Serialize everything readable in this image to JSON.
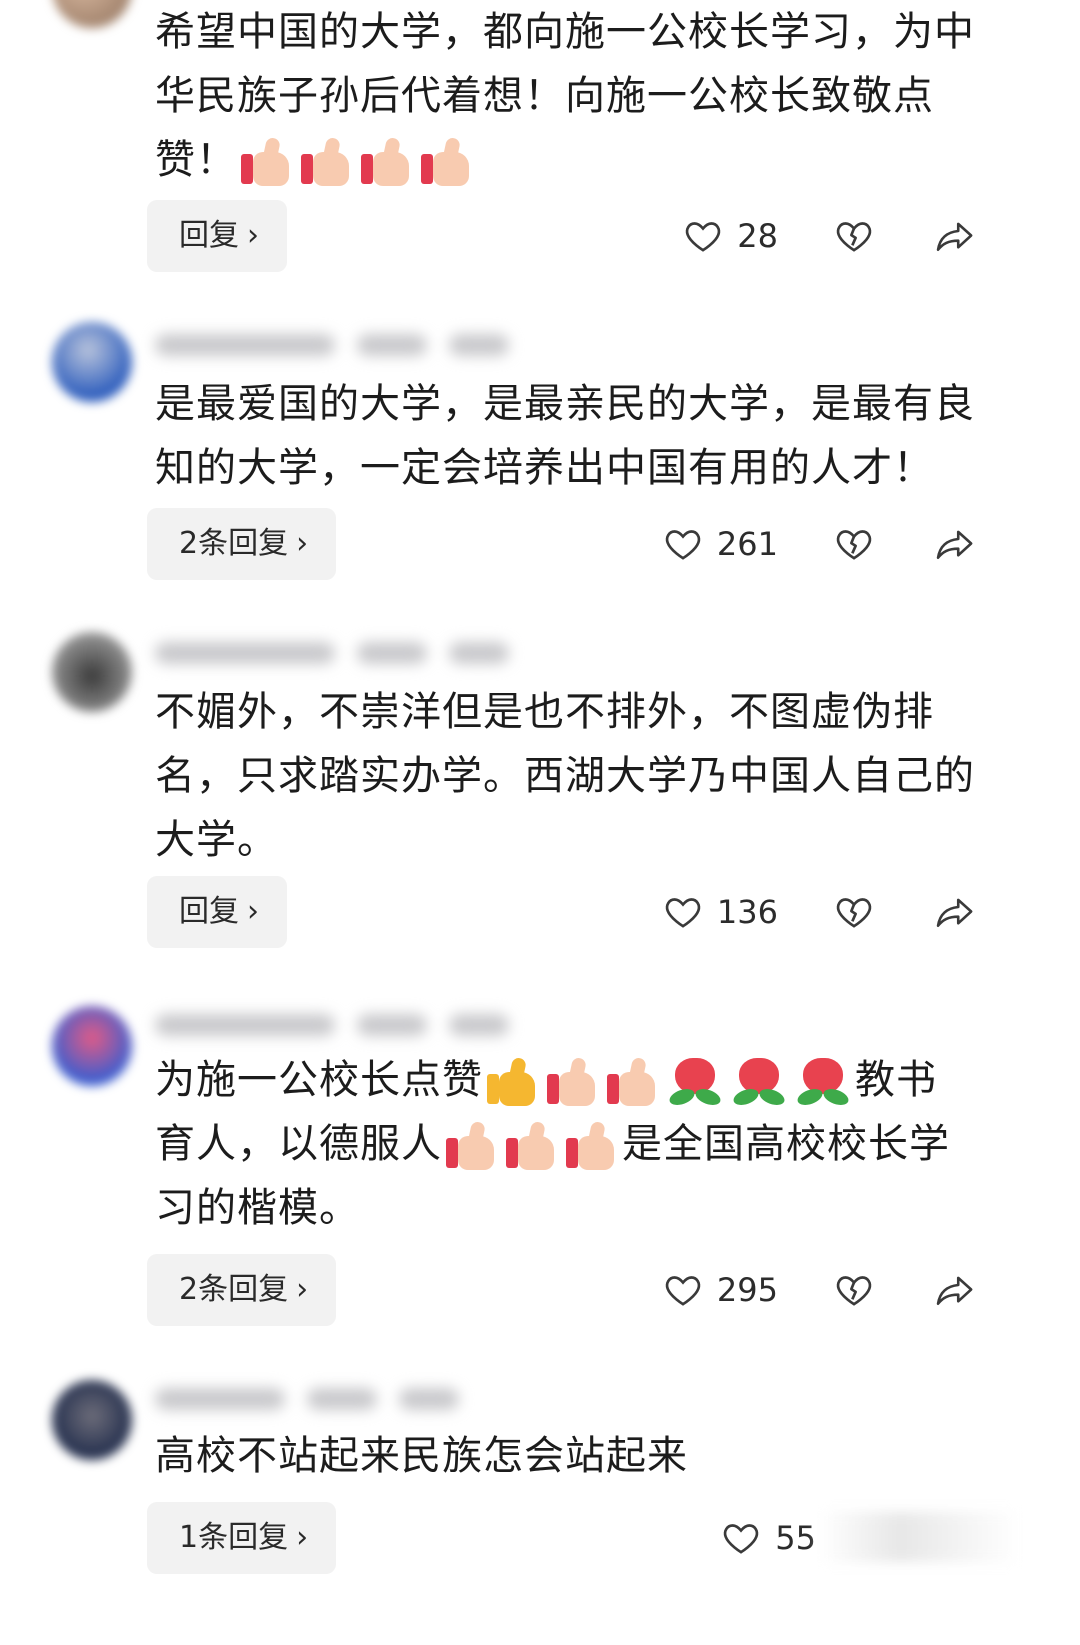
{
  "comments": [
    {
      "text_lines": [
        "希望中国的大学，都向施一公校长学习，为中",
        "华民族子孙后代着想！向施一公校长致敬点",
        "赞！"
      ],
      "reply_label": "回复",
      "likes": "28"
    },
    {
      "text_lines": [
        "是最爱国的大学，是最亲民的大学，是最有良",
        "知的大学，一定会培养出中国有用的人才！"
      ],
      "reply_label": "2条回复",
      "likes": "261"
    },
    {
      "text_lines": [
        "不媚外，不崇洋但是也不排外，不图虚伪排",
        "名，只求踏实办学。西湖大学乃中国人自己的",
        "大学。"
      ],
      "reply_label": "回复",
      "likes": "136"
    },
    {
      "text_parts": {
        "l1a": "为施一公校长点赞",
        "l1b": "教书",
        "l2a": "育人，以德服人",
        "l2b": "是全国高校校长学",
        "l3": "习的楷模。"
      },
      "reply_label": "2条回复",
      "likes": "295"
    },
    {
      "text_lines": [
        "高校不站起来民族怎会站起来"
      ],
      "reply_label": "1条回复",
      "likes": "55"
    }
  ],
  "icons": {
    "like": "heart-outline-icon",
    "dislike": "broken-heart-icon",
    "share": "share-arrow-icon",
    "chevron": "chevron-right-icon"
  },
  "colors": {
    "reply_button_bg": "#f2f2f2",
    "text": "#1c1c1c"
  }
}
